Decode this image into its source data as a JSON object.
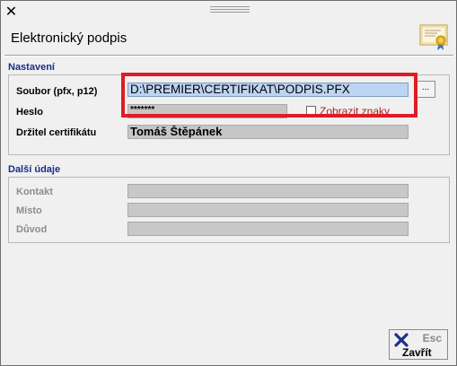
{
  "window": {
    "title": "Elektronický podpis",
    "close_glyph": "✕"
  },
  "sections": {
    "settings": {
      "title": "Nastavení"
    },
    "other": {
      "title": "Další údaje"
    }
  },
  "fields": {
    "file": {
      "label": "Soubor (pfx, p12)",
      "value": "D:\\PREMIER\\CERTIFIKAT\\PODPIS.PFX",
      "browse_label": "..."
    },
    "password": {
      "label": "Heslo",
      "value": "*******"
    },
    "show_chars": {
      "label": "Zobrazit znaky",
      "checked": false
    },
    "holder": {
      "label": "Držitel certifikátu",
      "value": "Tomáš Štěpánek"
    },
    "contact": {
      "label": "Kontakt",
      "value": ""
    },
    "place": {
      "label": "Místo",
      "value": ""
    },
    "reason": {
      "label": "Důvod",
      "value": ""
    }
  },
  "buttons": {
    "close": {
      "shortcut": "Esc",
      "label": "Zavřít"
    }
  },
  "colors": {
    "section_title": "#1a2c8a",
    "highlight": "#e01b25",
    "active_field": "#bdd4f2",
    "checkbox_label": "#b02020"
  },
  "icons": {
    "header": "certificate-icon",
    "close_button": "x-icon"
  }
}
